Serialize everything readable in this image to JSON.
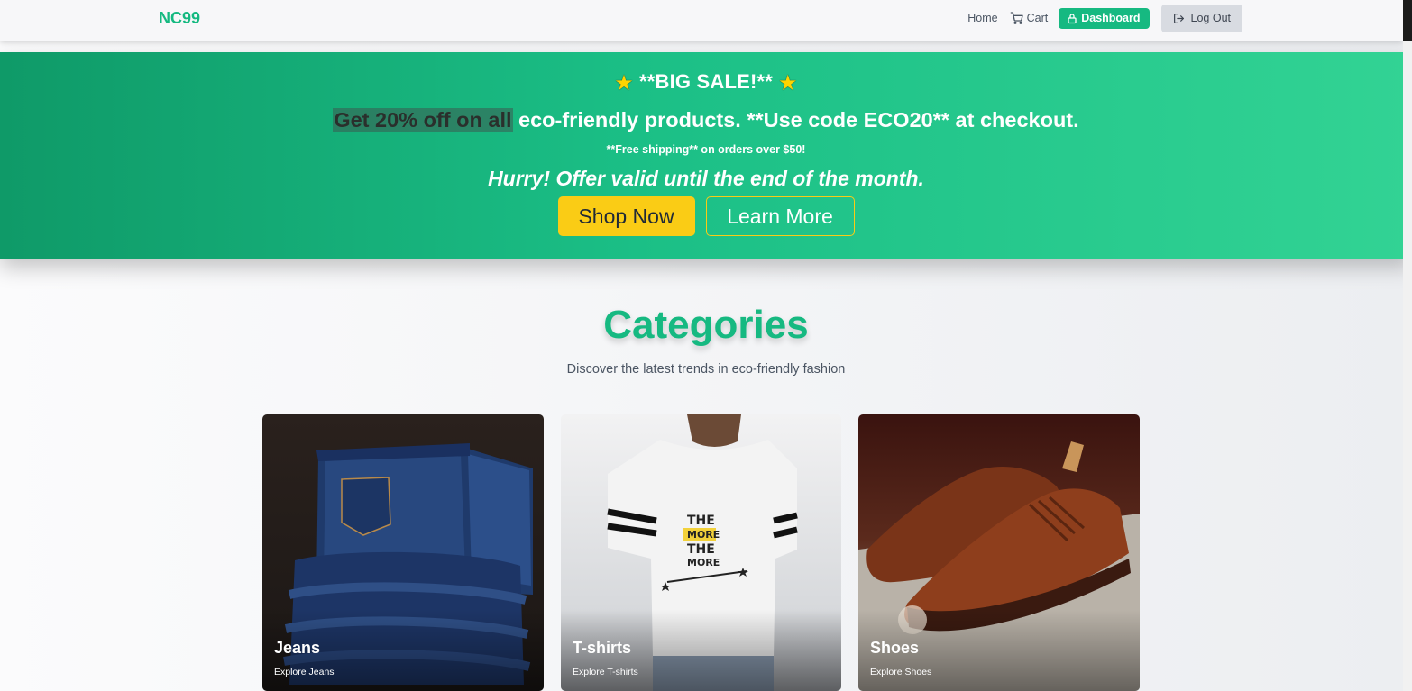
{
  "brand": {
    "name": "NC99",
    "color": "#16b981"
  },
  "nav": {
    "home": "Home",
    "cart": "Cart",
    "dashboard": "Dashboard",
    "logout": "Log Out",
    "icons": {
      "cart": "shopping-cart-icon",
      "dashboard": "lock-icon",
      "logout": "logout-icon"
    }
  },
  "banner": {
    "title": "**BIG SALE!**",
    "title_icon": "star-icon",
    "line1_highlight": "Get 20% off on all",
    "line1_rest": " eco-friendly products. **Use code ECO20** at checkout.",
    "line2": "**Free shipping** on orders over $50!",
    "line3": "Hurry! Offer valid until the end of the month.",
    "shop_button": "Shop Now",
    "learn_button": "Learn More",
    "colors": {
      "gradient_start": "#0f9a68",
      "gradient_end": "#32d394",
      "accent": "#facc15"
    }
  },
  "categories": {
    "title": "Categories",
    "subtitle": "Discover the latest trends in eco-friendly fashion",
    "items": [
      {
        "name": "Jeans",
        "link": "Explore Jeans",
        "image": "jeans-image"
      },
      {
        "name": "T-shirts",
        "link": "Explore T-shirts",
        "image": "tshirt-image"
      },
      {
        "name": "Shoes",
        "link": "Explore Shoes",
        "image": "shoes-image"
      }
    ]
  }
}
